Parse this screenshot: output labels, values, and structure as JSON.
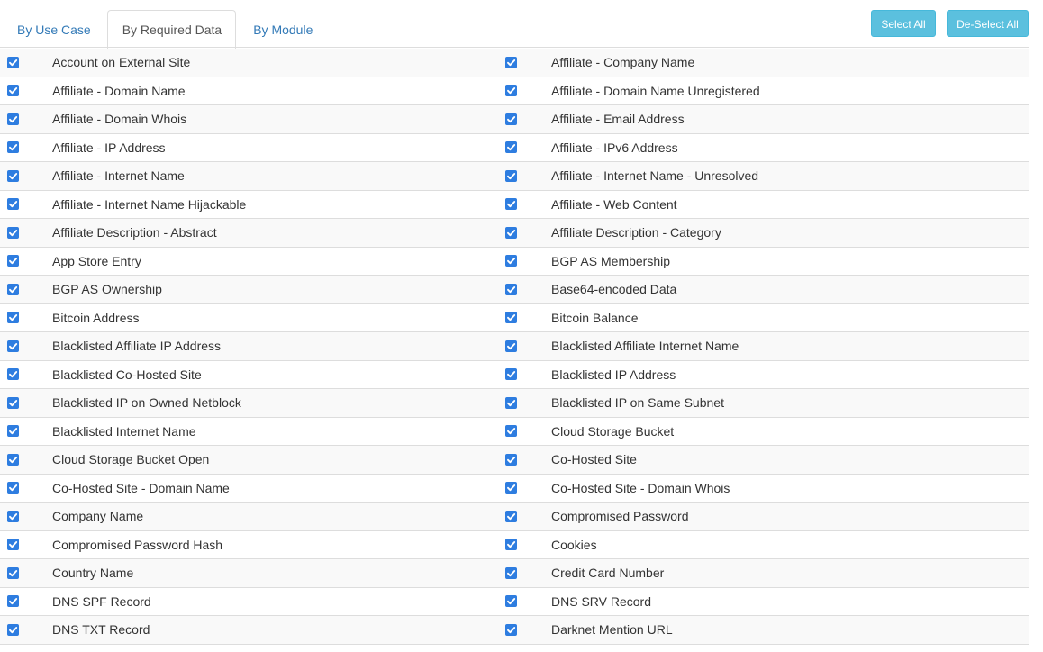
{
  "tabs": [
    {
      "label": "By Use Case",
      "active": false
    },
    {
      "label": "By Required Data",
      "active": true
    },
    {
      "label": "By Module",
      "active": false
    }
  ],
  "buttons": {
    "select_all": "Select All",
    "deselect_all": "De-Select All"
  },
  "colors": {
    "link": "#337ab7",
    "info_button": "#5bc0de",
    "checkbox": "#2e7de0",
    "stripe": "#f9f9f9"
  },
  "rows": [
    {
      "left": {
        "label": "Account on External Site",
        "checked": true
      },
      "right": {
        "label": "Affiliate - Company Name",
        "checked": true
      }
    },
    {
      "left": {
        "label": "Affiliate - Domain Name",
        "checked": true
      },
      "right": {
        "label": "Affiliate - Domain Name Unregistered",
        "checked": true
      }
    },
    {
      "left": {
        "label": "Affiliate - Domain Whois",
        "checked": true
      },
      "right": {
        "label": "Affiliate - Email Address",
        "checked": true
      }
    },
    {
      "left": {
        "label": "Affiliate - IP Address",
        "checked": true
      },
      "right": {
        "label": "Affiliate - IPv6 Address",
        "checked": true
      }
    },
    {
      "left": {
        "label": "Affiliate - Internet Name",
        "checked": true
      },
      "right": {
        "label": "Affiliate - Internet Name - Unresolved",
        "checked": true
      }
    },
    {
      "left": {
        "label": "Affiliate - Internet Name Hijackable",
        "checked": true
      },
      "right": {
        "label": "Affiliate - Web Content",
        "checked": true
      }
    },
    {
      "left": {
        "label": "Affiliate Description - Abstract",
        "checked": true
      },
      "right": {
        "label": "Affiliate Description - Category",
        "checked": true
      }
    },
    {
      "left": {
        "label": "App Store Entry",
        "checked": true
      },
      "right": {
        "label": "BGP AS Membership",
        "checked": true
      }
    },
    {
      "left": {
        "label": "BGP AS Ownership",
        "checked": true
      },
      "right": {
        "label": "Base64-encoded Data",
        "checked": true
      }
    },
    {
      "left": {
        "label": "Bitcoin Address",
        "checked": true
      },
      "right": {
        "label": "Bitcoin Balance",
        "checked": true
      }
    },
    {
      "left": {
        "label": "Blacklisted Affiliate IP Address",
        "checked": true
      },
      "right": {
        "label": "Blacklisted Affiliate Internet Name",
        "checked": true
      }
    },
    {
      "left": {
        "label": "Blacklisted Co-Hosted Site",
        "checked": true
      },
      "right": {
        "label": "Blacklisted IP Address",
        "checked": true
      }
    },
    {
      "left": {
        "label": "Blacklisted IP on Owned Netblock",
        "checked": true
      },
      "right": {
        "label": "Blacklisted IP on Same Subnet",
        "checked": true
      }
    },
    {
      "left": {
        "label": "Blacklisted Internet Name",
        "checked": true
      },
      "right": {
        "label": "Cloud Storage Bucket",
        "checked": true
      }
    },
    {
      "left": {
        "label": "Cloud Storage Bucket Open",
        "checked": true
      },
      "right": {
        "label": "Co-Hosted Site",
        "checked": true
      }
    },
    {
      "left": {
        "label": "Co-Hosted Site - Domain Name",
        "checked": true
      },
      "right": {
        "label": "Co-Hosted Site - Domain Whois",
        "checked": true
      }
    },
    {
      "left": {
        "label": "Company Name",
        "checked": true
      },
      "right": {
        "label": "Compromised Password",
        "checked": true
      }
    },
    {
      "left": {
        "label": "Compromised Password Hash",
        "checked": true
      },
      "right": {
        "label": "Cookies",
        "checked": true
      }
    },
    {
      "left": {
        "label": "Country Name",
        "checked": true
      },
      "right": {
        "label": "Credit Card Number",
        "checked": true
      }
    },
    {
      "left": {
        "label": "DNS SPF Record",
        "checked": true
      },
      "right": {
        "label": "DNS SRV Record",
        "checked": true
      }
    },
    {
      "left": {
        "label": "DNS TXT Record",
        "checked": true
      },
      "right": {
        "label": "Darknet Mention URL",
        "checked": true
      }
    }
  ]
}
